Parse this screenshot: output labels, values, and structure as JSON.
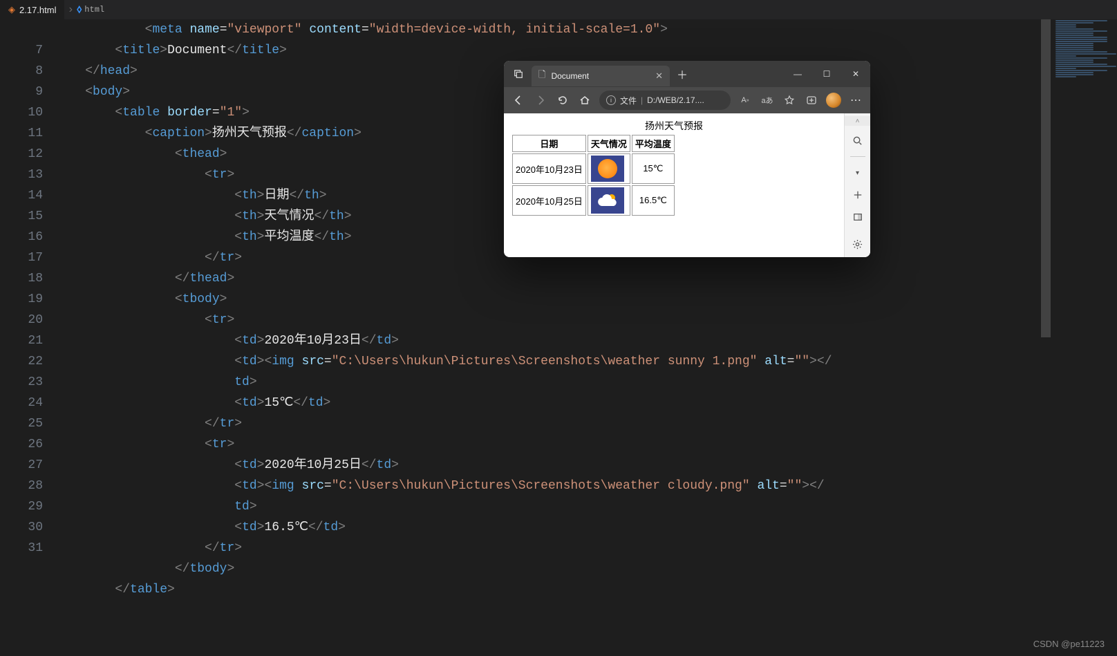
{
  "tab": {
    "filename": "2.17.html",
    "breadcrumb_item": "html"
  },
  "gutter": [
    "",
    "7",
    "8",
    "9",
    "10",
    "11",
    "12",
    "13",
    "14",
    "15",
    "16",
    "17",
    "18",
    "19",
    "20",
    "21",
    "22",
    "23",
    "24",
    "25",
    "26",
    "27",
    "28",
    "29",
    "30",
    "31"
  ],
  "code": {
    "l0": {
      "pre": "            ",
      "a": "<",
      "b": "meta",
      "c": " ",
      "d": "name",
      "e": "=",
      "f": "\"viewport\"",
      "g": " ",
      "h": "content",
      "i": "=",
      "j": "\"width=device-width, initial-scale=1.0\"",
      "k": ">"
    },
    "l7": {
      "in": "        ",
      "o1": "<",
      "t1": "title",
      "c1": ">",
      "tx": "Document",
      "o2": "</",
      "t2": "title",
      "c2": ">"
    },
    "l8": {
      "in": "    ",
      "o": "</",
      "t": "head",
      "c": ">"
    },
    "l9": {
      "in": "    ",
      "o": "<",
      "t": "body",
      "c": ">"
    },
    "l10": {
      "in": "        ",
      "o": "<",
      "t": "table",
      "sp": " ",
      "a": "border",
      "eq": "=",
      "v": "\"1\"",
      "c": ">"
    },
    "l11": {
      "in": "            ",
      "o": "<",
      "t": "caption",
      "c": ">",
      "tx": "扬州天气预报",
      "o2": "</",
      "t2": "caption",
      "c2": ">"
    },
    "l12": {
      "in": "                ",
      "o": "<",
      "t": "thead",
      "c": ">"
    },
    "l13": {
      "in": "                    ",
      "o": "<",
      "t": "tr",
      "c": ">"
    },
    "l14": {
      "in": "                        ",
      "o": "<",
      "t": "th",
      "c": ">",
      "tx": "日期",
      "o2": "</",
      "t2": "th",
      "c2": ">"
    },
    "l15": {
      "in": "                        ",
      "o": "<",
      "t": "th",
      "c": ">",
      "tx": "天气情况",
      "o2": "</",
      "t2": "th",
      "c2": ">"
    },
    "l16": {
      "in": "                        ",
      "o": "<",
      "t": "th",
      "c": ">",
      "tx": "平均温度",
      "o2": "</",
      "t2": "th",
      "c2": ">"
    },
    "l17": {
      "in": "                    ",
      "o": "</",
      "t": "tr",
      "c": ">"
    },
    "l18": {
      "in": "                ",
      "o": "</",
      "t": "thead",
      "c": ">"
    },
    "l19": {
      "in": "                ",
      "o": "<",
      "t": "tbody",
      "c": ">"
    },
    "l20": {
      "in": "                    ",
      "o": "<",
      "t": "tr",
      "c": ">"
    },
    "l21": {
      "in": "                        ",
      "o": "<",
      "t": "td",
      "c": ">",
      "tx": "2020年10月23日",
      "o2": "</",
      "t2": "td",
      "c2": ">"
    },
    "l22": {
      "in": "                        ",
      "o": "<",
      "t": "td",
      "c": ">",
      "o3": "<",
      "t3": "img",
      "sp": " ",
      "a1": "src",
      "eq": "=",
      "v1": "\"C:\\Users\\hukun\\Pictures\\Screenshots\\weather sunny 1.png\"",
      "sp2": " ",
      "a2": "alt",
      "eq2": "=",
      "v2": "\"\"",
      "c3": ">",
      "o4": "</"
    },
    "l22b": {
      "in": "                        ",
      "t": "td",
      "c": ">"
    },
    "l23": {
      "in": "                        ",
      "o": "<",
      "t": "td",
      "c": ">",
      "tx": "15℃",
      "o2": "</",
      "t2": "td",
      "c2": ">"
    },
    "l24": {
      "in": "                    ",
      "o": "</",
      "t": "tr",
      "c": ">"
    },
    "l25": {
      "in": "                    ",
      "o": "<",
      "t": "tr",
      "c": ">"
    },
    "l26": {
      "in": "                        ",
      "o": "<",
      "t": "td",
      "c": ">",
      "tx": "2020年10月25日",
      "o2": "</",
      "t2": "td",
      "c2": ">"
    },
    "l27": {
      "in": "                        ",
      "o": "<",
      "t": "td",
      "c": ">",
      "o3": "<",
      "t3": "img",
      "sp": " ",
      "a1": "src",
      "eq": "=",
      "v1": "\"C:\\Users\\hukun\\Pictures\\Screenshots\\weather cloudy.png\"",
      "sp2": " ",
      "a2": "alt",
      "eq2": "=",
      "v2": "\"\"",
      "c3": ">",
      "o4": "</"
    },
    "l27b": {
      "in": "                        ",
      "t": "td",
      "c": ">"
    },
    "l28": {
      "in": "                        ",
      "o": "<",
      "t": "td",
      "c": ">",
      "tx": "16.5℃",
      "o2": "</",
      "t2": "td",
      "c2": ">"
    },
    "l29": {
      "in": "                    ",
      "o": "</",
      "t": "tr",
      "c": ">"
    },
    "l30": {
      "in": "                ",
      "o": "</",
      "t": "tbody",
      "c": ">"
    },
    "l31": {
      "in": "        ",
      "o": "</",
      "t": "table",
      "c": ">"
    }
  },
  "browser": {
    "tab_title": "Document",
    "url_label_file": "文件",
    "url_path": "D:/WEB/2.17....",
    "page": {
      "caption": "扬州天气预报",
      "head": [
        "日期",
        "天气情况",
        "平均温度"
      ],
      "rows": [
        {
          "date": "2020年10月23日",
          "temp": "15℃"
        },
        {
          "date": "2020年10月25日",
          "temp": "16.5℃"
        }
      ]
    }
  },
  "watermark": "CSDN @pe11223"
}
